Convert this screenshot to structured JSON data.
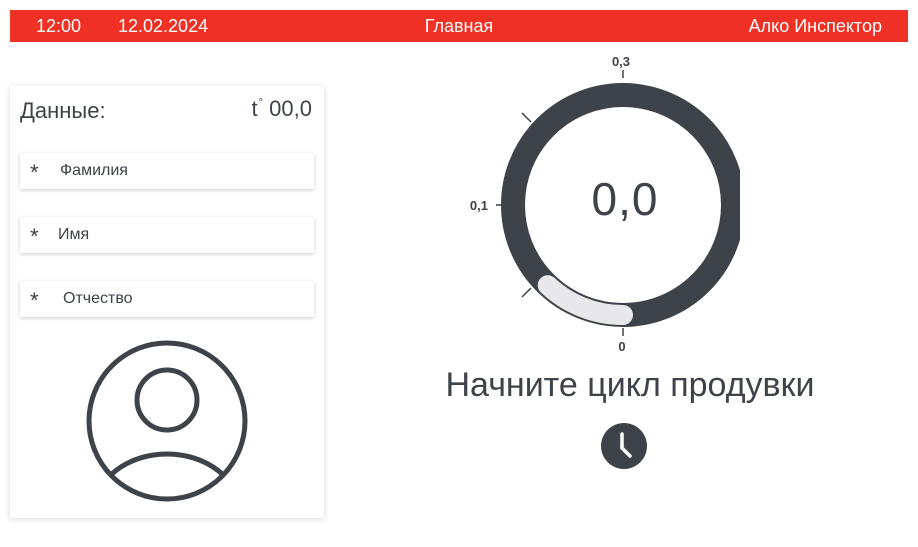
{
  "header": {
    "time": "12:00",
    "date": "12.02.2024",
    "title": "Главная",
    "app_name": "Алко Инспектор"
  },
  "data_panel": {
    "heading": "Данные:",
    "temperature": {
      "symbol": "t",
      "degree": "°",
      "value": "00,0"
    },
    "fields": [
      {
        "required_mark": "*",
        "placeholder": "Фамилия"
      },
      {
        "required_mark": "*",
        "placeholder": "Имя"
      },
      {
        "required_mark": "*",
        "placeholder": "Отчество"
      }
    ],
    "avatar_icon": "user-avatar-icon"
  },
  "gauge": {
    "value": "0,0",
    "scale_labels": {
      "bottom": "0",
      "left": "0,1",
      "top": "0,3"
    },
    "progress_fraction": 0.12,
    "colors": {
      "track": "#3e4249",
      "progress": "#e8e8ea"
    }
  },
  "status": {
    "prompt": "Начните цикл продувки",
    "icon": "clock-icon"
  },
  "colors": {
    "accent": "#ee3124",
    "text": "#3e4249"
  }
}
